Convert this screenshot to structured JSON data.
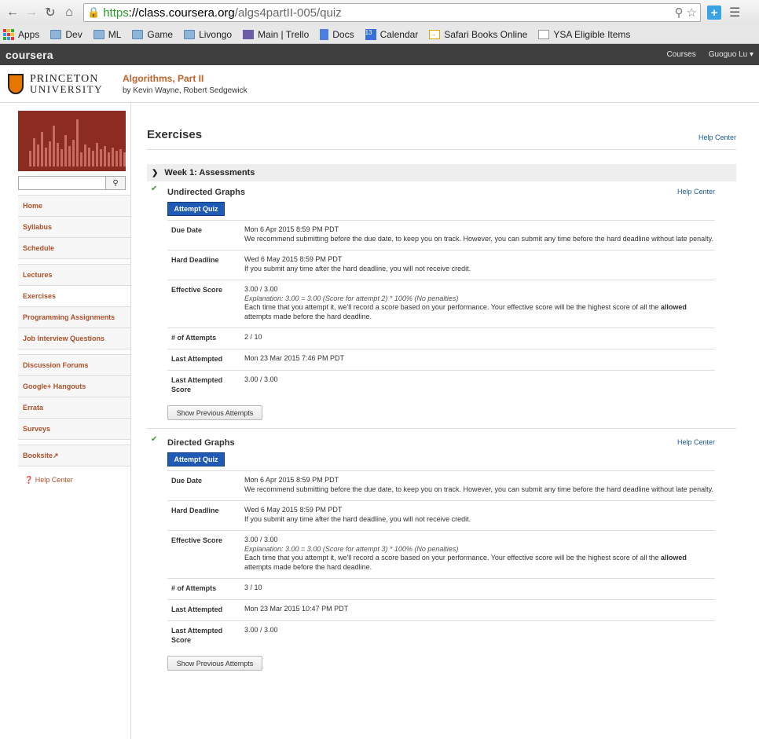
{
  "browser": {
    "url_scheme": "https",
    "url_host": "://class.coursera.org",
    "url_path": "/algs4partII-005/quiz",
    "bookmarks": [
      {
        "label": "Apps",
        "icon": "apps-grid-icon"
      },
      {
        "label": "Dev",
        "icon": "folder-icon"
      },
      {
        "label": "ML",
        "icon": "folder-icon"
      },
      {
        "label": "Game",
        "icon": "folder-icon"
      },
      {
        "label": "Livongo",
        "icon": "folder-icon"
      },
      {
        "label": "Main | Trello",
        "icon": "trello-icon"
      },
      {
        "label": "Docs",
        "icon": "docs-icon"
      },
      {
        "label": "Calendar",
        "icon": "calendar-icon"
      },
      {
        "label": "Safari Books Online",
        "icon": "safari-books-icon"
      },
      {
        "label": "YSA Eligible Items",
        "icon": "page-icon"
      }
    ],
    "calendar_day": "13"
  },
  "topbar": {
    "logo": "coursera",
    "courses": "Courses",
    "user": "Guoguo Lu ▾"
  },
  "course": {
    "university_line1": "PRINCETON",
    "university_line2": "UNIVERSITY",
    "title": "Algorithms, Part II",
    "by": "by Kevin Wayne, Robert Sedgewick"
  },
  "sidebar": {
    "groups": [
      [
        "Home",
        "Syllabus",
        "Schedule"
      ],
      [
        "Lectures",
        "Exercises",
        "Programming Assignments",
        "Job Interview Questions"
      ],
      [
        "Discussion Forums",
        "Google+ Hangouts",
        "Errata",
        "Surveys"
      ],
      [
        "Booksite"
      ]
    ],
    "active": "Exercises",
    "help": "Help Center"
  },
  "page": {
    "title": "Exercises",
    "help": "Help Center",
    "week": "Week 1: Assessments",
    "attempt_label": "Attempt Quiz",
    "prev_label": "Show Previous Attempts",
    "labels": {
      "due": "Due Date",
      "hard": "Hard Deadline",
      "score": "Effective Score",
      "attempts": "# of Attempts",
      "last": "Last Attempted",
      "last_score_l1": "Last Attempted",
      "last_score_l2": "Score"
    },
    "due_note": "We recommend submitting before the due date, to keep you on track. However, you can submit any time before the hard deadline without late penalty.",
    "hard_note": "If you submit any time after the hard deadline, you will not receive credit.",
    "score_note_a": "Each time that you attempt it, we'll record a score based on your performance. Your effective score will be the highest score of all the ",
    "score_note_b": "allowed",
    "score_note_c": " attempts made before the hard deadline.",
    "quizzes": [
      {
        "title": "Undirected Graphs",
        "help": "Help Center",
        "due": "Mon 6 Apr 2015 8:59 PM PDT",
        "hard": "Wed 6 May 2015 8:59 PM PDT",
        "score": "3.00 / 3.00",
        "explanation": "Explanation: 3.00 = 3.00 (Score for attempt 2) * 100% (No penalties)",
        "attempts": "2 / 10",
        "last": "Mon 23 Mar 2015 7:46 PM PDT",
        "last_score": "3.00 / 3.00"
      },
      {
        "title": "Directed Graphs",
        "help": "Help Center",
        "due": "Mon 6 Apr 2015 8:59 PM PDT",
        "hard": "Wed 6 May 2015 8:59 PM PDT",
        "score": "3.00 / 3.00",
        "explanation": "Explanation: 3.00 = 3.00 (Score for attempt 3) * 100% (No penalties)",
        "attempts": "3 / 10",
        "last": "Mon 23 Mar 2015 10:47 PM PDT",
        "last_score": "3.00 / 3.00"
      }
    ]
  }
}
